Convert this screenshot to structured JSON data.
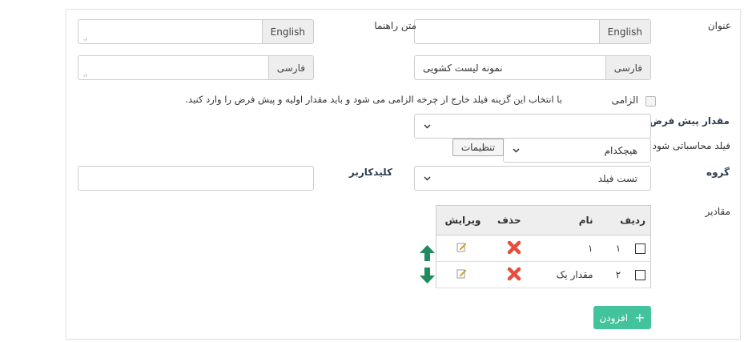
{
  "form": {
    "title_label": "عنوان",
    "hint_label": "متن راهنما",
    "lang_english": "English",
    "lang_farsi": "فارسی",
    "title_english_value": "",
    "title_farsi_value": "نمونه لیست کشویی",
    "hint_english_value": "",
    "hint_farsi_value": "",
    "required_label": "الزامی",
    "required_note": "با انتخاب این گزینه فیلد خارج از چرخه الزامی می شود و باید مقدار اولیه و پیش فرض را وارد کنید.",
    "default_value_label": "مقدار پیش فرض",
    "default_value_selected": "",
    "computed_field_label": "فیلد محاسباتی شود",
    "computed_field_selected": "هیچکدام",
    "settings_button": "تنظیمات",
    "group_label": "گروه",
    "group_selected": "تست فیلد",
    "keyword_label": "کلیدکاربر",
    "keyword_value": "",
    "values_label": "مقادیر"
  },
  "values_table": {
    "columns": [
      "ردیف",
      "نام",
      "حذف",
      "ویرایش"
    ],
    "rows": [
      {
        "index": "۱",
        "name": "۱"
      },
      {
        "index": "۲",
        "name": "مقدار یک"
      }
    ]
  },
  "add_button": "افزودن",
  "colors": {
    "accent": "#42c39b",
    "arrow": "#1e8c5e",
    "delete": "#e74c3c"
  }
}
